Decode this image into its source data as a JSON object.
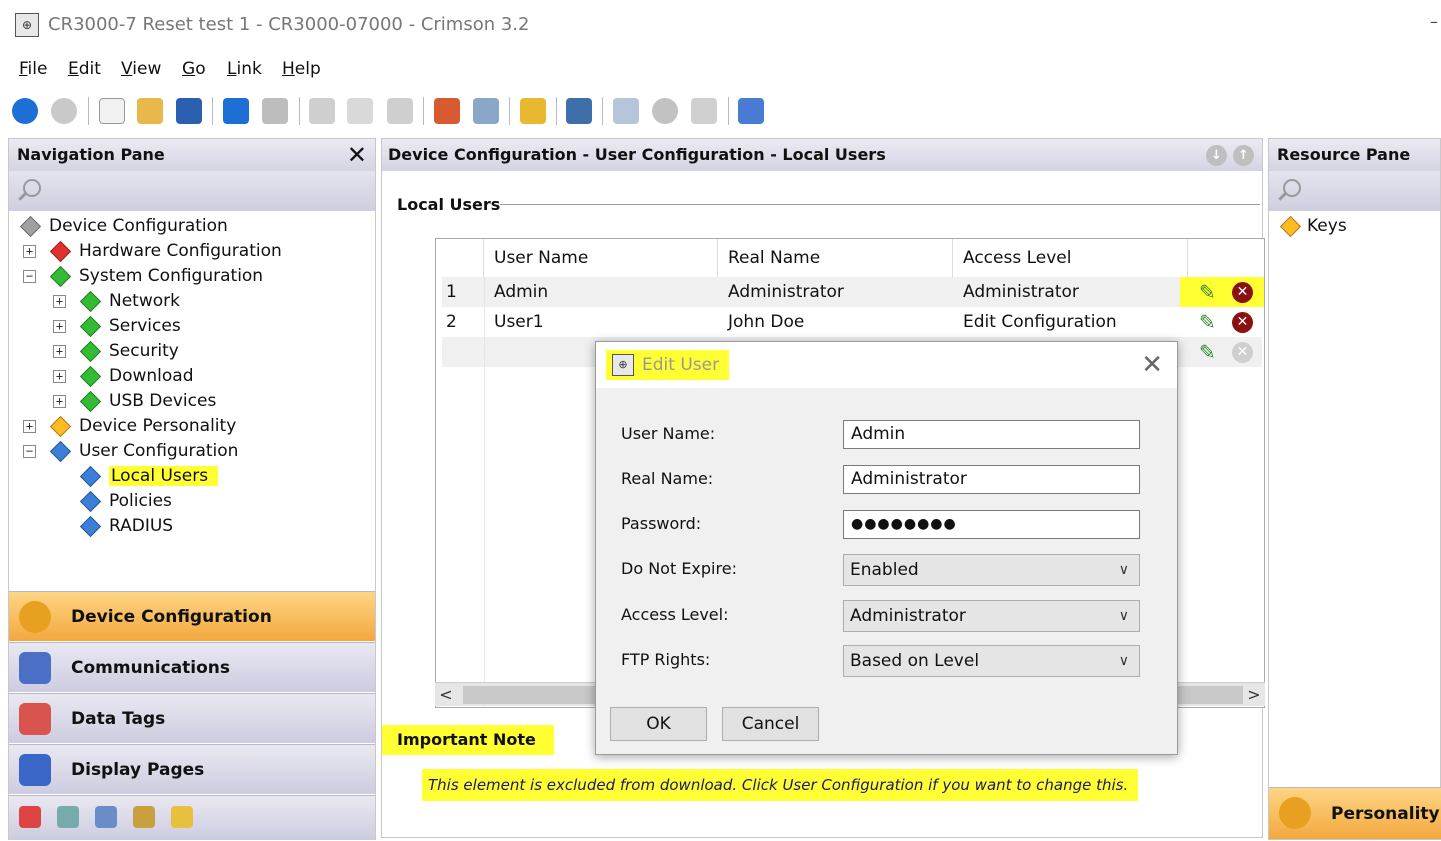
{
  "window": {
    "title": "CR3000-7 Reset test 1 - CR3000-07000 - Crimson 3.2",
    "minimize_glyph": "–"
  },
  "menu": {
    "items": [
      {
        "first": "F",
        "rest": "ile"
      },
      {
        "first": "E",
        "rest": "dit"
      },
      {
        "first": "V",
        "rest": "iew"
      },
      {
        "first": "G",
        "rest": "o"
      },
      {
        "first": "L",
        "rest": "ink"
      },
      {
        "first": "H",
        "rest": "elp"
      }
    ]
  },
  "toolbar": {
    "icons": [
      "back-icon",
      "forward-icon",
      "new-icon",
      "open-icon",
      "save-icon",
      "undo-icon",
      "redo-icon",
      "cut-icon",
      "copy-icon",
      "paste-icon",
      "find-all-icon",
      "find-icon",
      "link-icon",
      "monitor-icon",
      "search-doc-icon",
      "globe-icon",
      "print-icon",
      "pin-icon"
    ]
  },
  "nav_pane": {
    "title": "Navigation Pane",
    "close_glyph": "✕",
    "tree": [
      {
        "label": "Device Configuration",
        "color": "#a0a0a0",
        "expander": ""
      },
      {
        "label": "Hardware Configuration",
        "color": "#e03030",
        "expander": "+"
      },
      {
        "label": "System Configuration",
        "color": "#33bb33",
        "expander": "−"
      },
      {
        "label": "Network",
        "color": "#33bb33",
        "expander": "+"
      },
      {
        "label": "Services",
        "color": "#33bb33",
        "expander": "+"
      },
      {
        "label": "Security",
        "color": "#33bb33",
        "expander": "+"
      },
      {
        "label": "Download",
        "color": "#33bb33",
        "expander": "+"
      },
      {
        "label": "USB Devices",
        "color": "#33bb33",
        "expander": "+"
      },
      {
        "label": "Device Personality",
        "color": "#ffbb22",
        "expander": "+"
      },
      {
        "label": "User Configuration",
        "color": "#3b7fd8",
        "expander": "−"
      },
      {
        "label": "Local Users",
        "color": "#3b7fd8",
        "expander": ""
      },
      {
        "label": "Policies",
        "color": "#3b7fd8",
        "expander": ""
      },
      {
        "label": "RADIUS",
        "color": "#3b7fd8",
        "expander": ""
      }
    ],
    "categories": [
      {
        "label": "Device Configuration",
        "active": true
      },
      {
        "label": "Communications",
        "active": false
      },
      {
        "label": "Data Tags",
        "active": false
      },
      {
        "label": "Display Pages",
        "active": false
      }
    ]
  },
  "main_pane": {
    "title": "Device Configuration - User Configuration - Local Users",
    "prev_glyph": "↓",
    "next_glyph": "↑",
    "section_title": "Local Users",
    "columns": [
      "User Name",
      "Real Name",
      "Access Level"
    ],
    "rows": [
      {
        "num": "1",
        "user_name": "Admin",
        "real_name": "Administrator",
        "access_level": "Administrator"
      },
      {
        "num": "2",
        "user_name": "User1",
        "real_name": "John Doe",
        "access_level": "Edit Configuration"
      }
    ],
    "scroll_left": "<",
    "scroll_right": ">",
    "note_title": "Important Note",
    "note_text": "This element is excluded from download. Click User Configuration if you want to change this.",
    "edit_glyph": "✎",
    "delete_glyph": "✕"
  },
  "resource_pane": {
    "title": "Resource Pane",
    "items": [
      {
        "label": "Keys",
        "color": "#ffbb22"
      }
    ],
    "personality_label": "Personality"
  },
  "dialog": {
    "title": "Edit User",
    "close_glyph": "✕",
    "fields": {
      "user_name_label": "User Name:",
      "user_name_value": "Admin",
      "real_name_label": "Real Name:",
      "real_name_value": "Administrator",
      "password_label": "Password:",
      "password_value": "●●●●●●●●",
      "expire_label": "Do Not Expire:",
      "expire_value": "Enabled",
      "access_label": "Access Level:",
      "access_value": "Administrator",
      "ftp_label": "FTP Rights:",
      "ftp_value": "Based on Level"
    },
    "ok_label": "OK",
    "cancel_label": "Cancel"
  },
  "colors": {
    "highlight": "#ffff33",
    "active_category": "#f3a83e",
    "edit": "#2e8b2e",
    "delete": "#8b1010"
  }
}
